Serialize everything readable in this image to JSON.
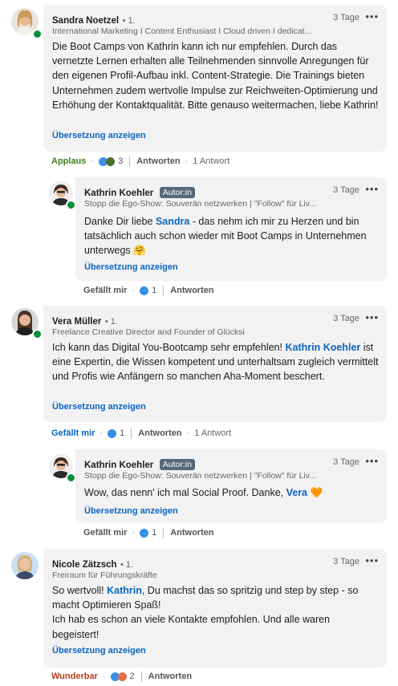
{
  "comments": [
    {
      "name": "Sandra Noetzel",
      "degree": "• 1.",
      "headline": "International Marketing I Content Enthusiast I Cloud driven I dedicat...",
      "time": "3 Tage",
      "body": "Die Boot Camps von Kathrin kann ich nur empfehlen. Durch das vernetzte Lernen erhalten alle Teilnehmenden sinnvolle Anregungen für den eigenen Profil-Aufbau inkl. Content-Strategie. Die Trainings bieten Unternehmen zudem wertvolle Impulse zur Reichweiten-Optimierung und Erhöhung der Kontaktqualität. Bitte genauso weitermachen, liebe Kathrin!",
      "translate": "Übersetzung anzeigen",
      "reaction_label": "Applaus",
      "reaction_color": "#3f7b1e",
      "reaction_count": "3",
      "reply_label": "Antworten",
      "replies_count": "1 Antwort"
    },
    {
      "name": "Kathrin Koehler",
      "badge": "Autor:in",
      "headline": "Stopp die Ego-Show: Souverän netzwerken | \"Follow\" für Liv...",
      "time": "3 Tage",
      "body_pre": "Danke Dir liebe ",
      "mention": "Sandra",
      "body_post": " - das nehm ich mir zu Herzen und bin tatsächlich auch schon wieder mit Boot Camps in Unternehmen unterwegs 🤗",
      "translate": "Übersetzung anzeigen",
      "like_label": "Gefällt mir",
      "reaction_count": "1",
      "reply_label": "Antworten"
    },
    {
      "name": "Vera Müller",
      "degree": "• 1.",
      "headline": "Freelance Creative Director and Founder of Glücksi",
      "time": "3 Tage",
      "body_pre": "Ich kann das Digital You-Bootcamp sehr empfehlen! ",
      "mention": "Kathrin Koehler",
      "body_post": " ist eine Expertin, die Wissen kompetent und unterhaltsam zugleich vermittelt und Profis wie Anfängern so manchen Aha-Moment beschert.",
      "translate": "Übersetzung anzeigen",
      "like_label": "Gefällt mir",
      "reaction_count": "1",
      "reply_label": "Antworten",
      "replies_count": "1 Antwort"
    },
    {
      "name": "Kathrin Koehler",
      "badge": "Autor:in",
      "headline": "Stopp die Ego-Show: Souverän netzwerken | \"Follow\" für Liv...",
      "time": "3 Tage",
      "body_pre": "Wow, das nenn' ich mal Social Proof. Danke, ",
      "mention": "Vera",
      "body_post": " 🧡",
      "translate": "Übersetzung anzeigen",
      "like_label": "Gefällt mir",
      "reaction_count": "1",
      "reply_label": "Antworten"
    },
    {
      "name": "Nicole Zätzsch",
      "degree": "• 1.",
      "headline": "Freiraum für Führungskräfte",
      "time": "3 Tage",
      "body_pre": "So wertvoll! ",
      "mention": "Kathrin",
      "body_post": ", Du machst das so spritzig und step by step - so macht Optimieren Spaß!",
      "body_line2": "Ich hab es schon an viele Kontakte empfohlen. Und alle waren begeistert!",
      "translate": "Übersetzung anzeigen",
      "reaction_label": "Wunderbar",
      "reaction_color": "#b24020",
      "reaction_count": "2",
      "reply_label": "Antworten"
    }
  ],
  "colors": {
    "link": "#0a66c2",
    "like_blue": "#378fe9",
    "online": "#0a8f3c"
  }
}
